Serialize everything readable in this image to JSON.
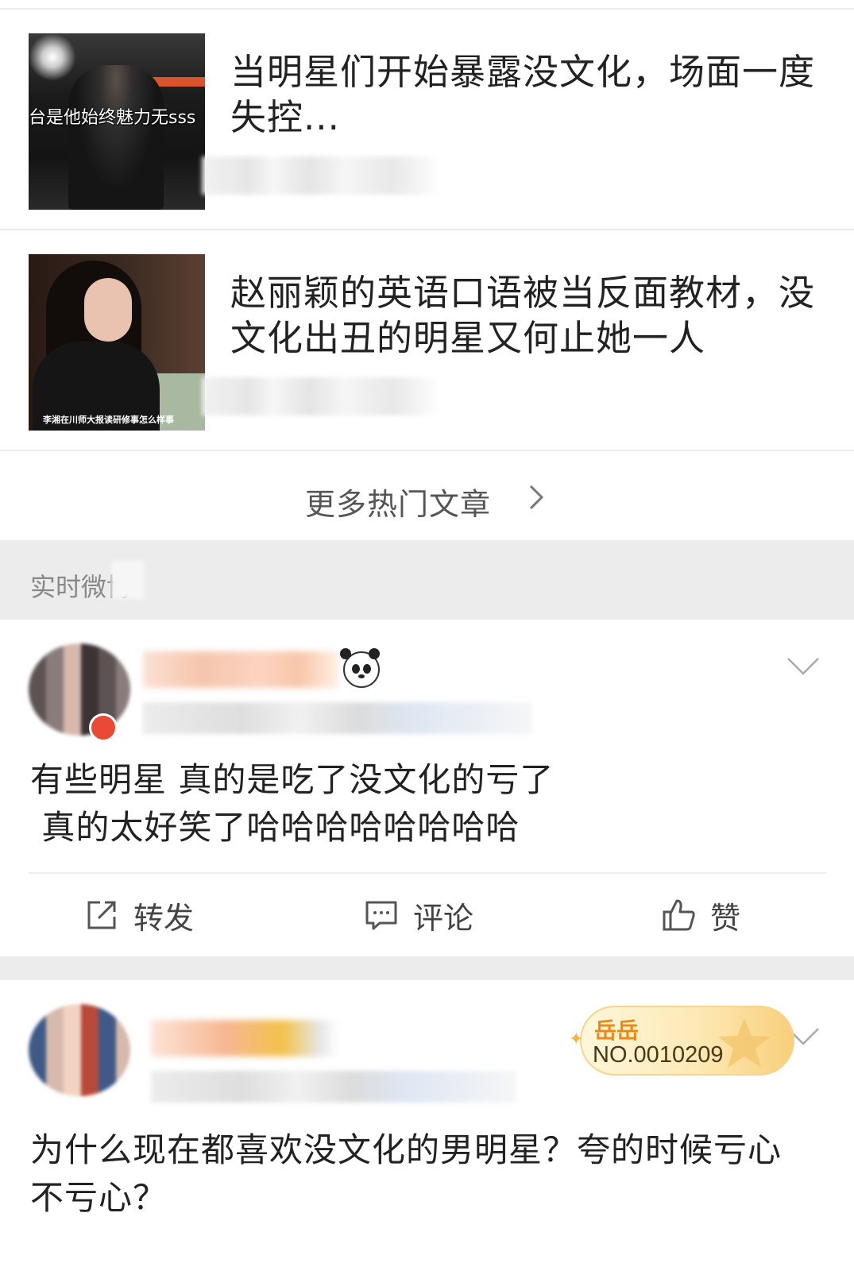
{
  "articles": [
    {
      "title": "当明星们开始暴露没文化，场面一度失控...",
      "thumb_caption": "台是他始终魅力无sss"
    },
    {
      "title": "赵丽颖的英语口语被当反面教材，没文化出丑的明星又何止她一人",
      "thumb_caption": "李湘在川师大报读研修事怎么样事"
    }
  ],
  "more_articles": {
    "label": "更多热门文章",
    "icon": "chevron-right-icon"
  },
  "section": {
    "label": "实时微博"
  },
  "posts": [
    {
      "text": "有些明星 真的是吃了没文化的亏了\n 真的太好笑了哈哈哈哈哈哈哈哈",
      "actions": {
        "repost": "转发",
        "comment": "评论",
        "like": "赞"
      }
    },
    {
      "text": "为什么现在都喜欢没文化的男明星？夸的时候亏心\n不亏心？",
      "fan_badge": {
        "tag": "岳岳",
        "number": "NO.0010209"
      }
    }
  ],
  "colors": {
    "divider": "#ececec",
    "section_bg": "#ececec",
    "badge_gold": "#f8cf7b"
  }
}
